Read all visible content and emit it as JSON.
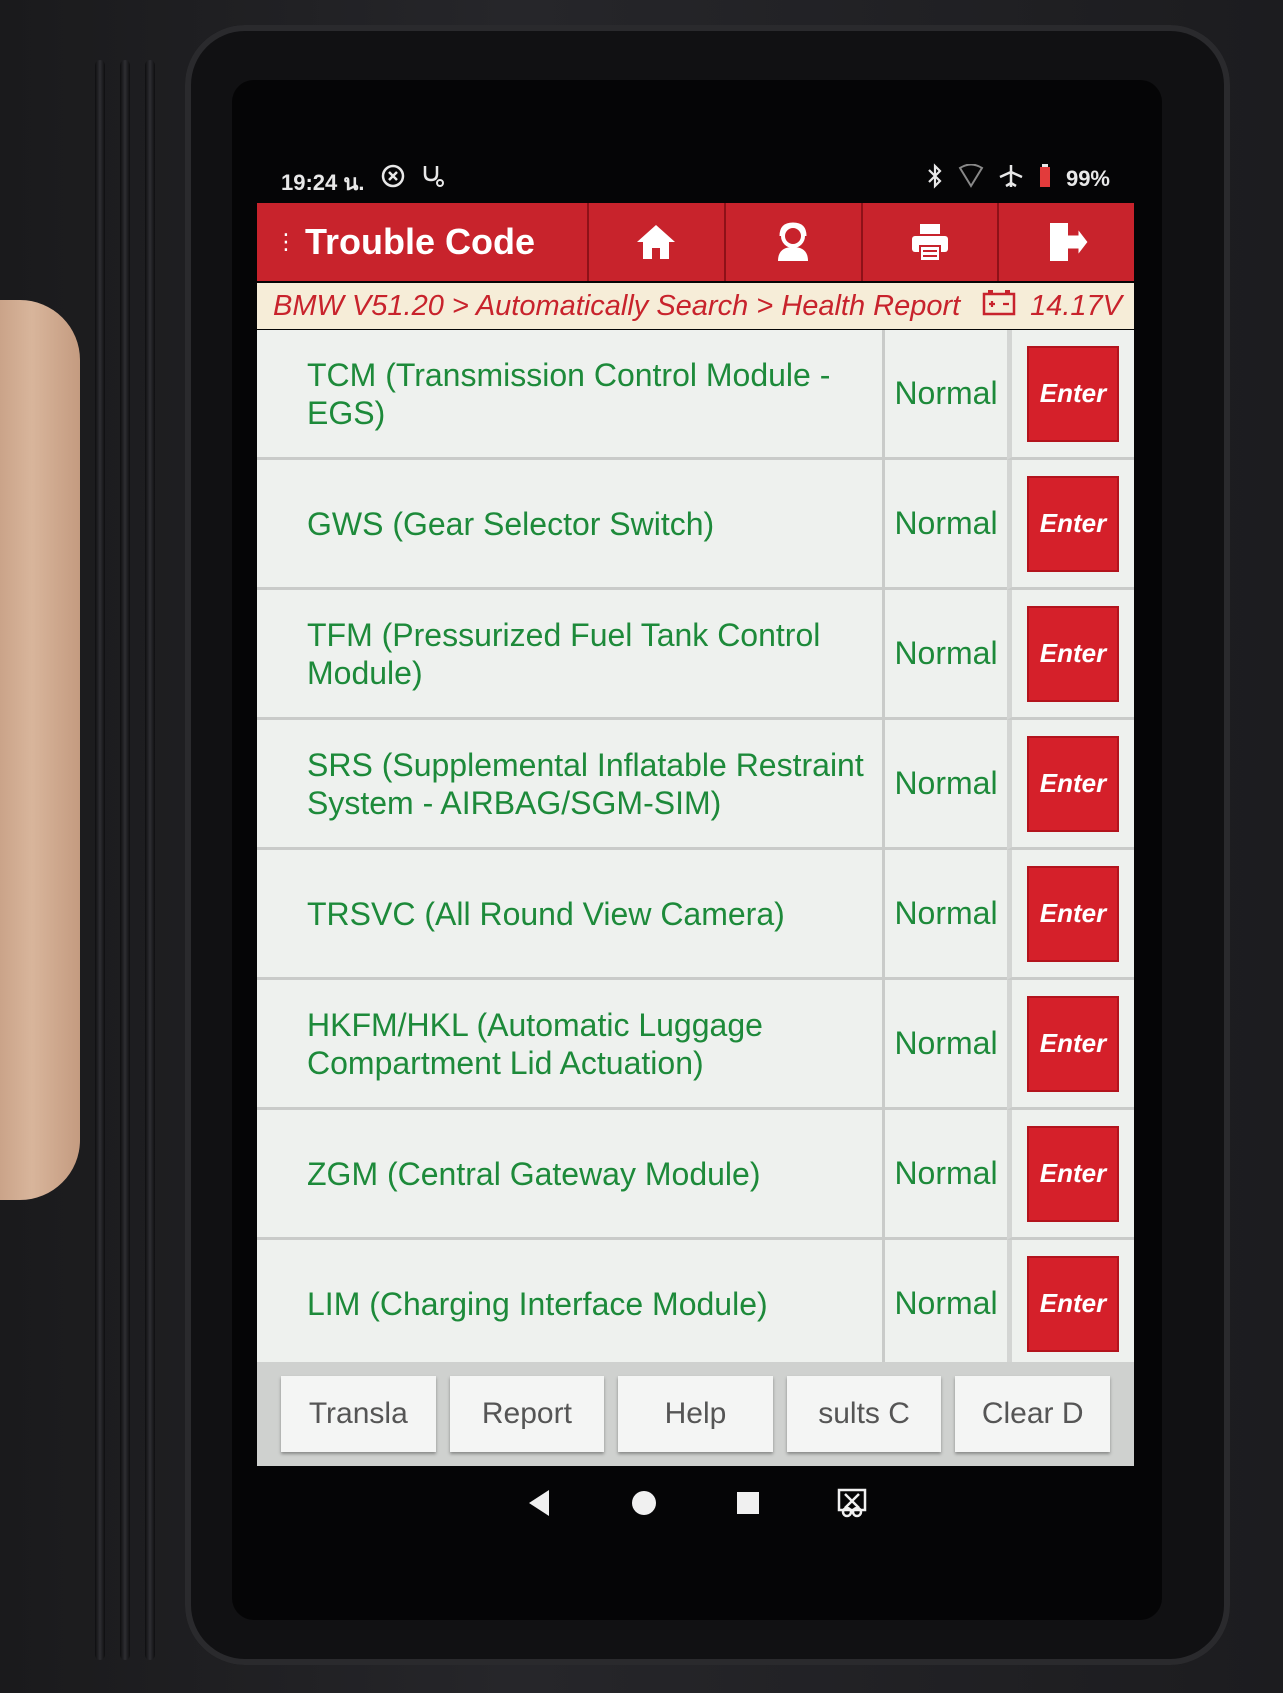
{
  "status_bar": {
    "time": "19:24 น.",
    "battery": "99%",
    "left_icons": [
      "vci-icon",
      "stethoscope-icon"
    ],
    "right_icons": [
      "bluetooth-icon",
      "wifi-icon",
      "airplane-icon",
      "battery-icon"
    ]
  },
  "header": {
    "title": "Trouble Code",
    "buttons": [
      {
        "name": "home",
        "icon": "home-icon"
      },
      {
        "name": "user",
        "icon": "user-icon"
      },
      {
        "name": "print",
        "icon": "printer-icon"
      },
      {
        "name": "exit",
        "icon": "exit-icon"
      }
    ],
    "color": "#c8232c"
  },
  "breadcrumb": {
    "path": "BMW V51.20 > Automatically Search > Health Report",
    "voltage": "14.17V"
  },
  "modules": [
    {
      "name": "TCM (Transmission Control Module - EGS)",
      "status": "Normal",
      "action": "Enter"
    },
    {
      "name": "GWS (Gear Selector Switch)",
      "status": "Normal",
      "action": "Enter"
    },
    {
      "name": "TFM (Pressurized Fuel Tank Control Module)",
      "status": "Normal",
      "action": "Enter"
    },
    {
      "name": "SRS (Supplemental Inflatable Restraint System - AIRBAG/SGM-SIM)",
      "status": "Normal",
      "action": "Enter"
    },
    {
      "name": "TRSVC (All Round View Camera)",
      "status": "Normal",
      "action": "Enter"
    },
    {
      "name": "HKFM/HKL (Automatic Luggage Compartment Lid Actuation)",
      "status": "Normal",
      "action": "Enter"
    },
    {
      "name": "ZGM (Central Gateway Module)",
      "status": "Normal",
      "action": "Enter"
    },
    {
      "name": "LIM (Charging Interface Module)",
      "status": "Normal",
      "action": "Enter"
    }
  ],
  "action_bar": {
    "buttons": [
      "Transla",
      "Report",
      "Help",
      "sults C",
      "Clear D"
    ]
  },
  "nav_bar": {
    "icons": [
      "back-icon",
      "home-circle-icon",
      "recents-icon",
      "screenshot-icon"
    ]
  },
  "colors": {
    "accent_red": "#c8232c",
    "status_green": "#1d8a3a"
  }
}
